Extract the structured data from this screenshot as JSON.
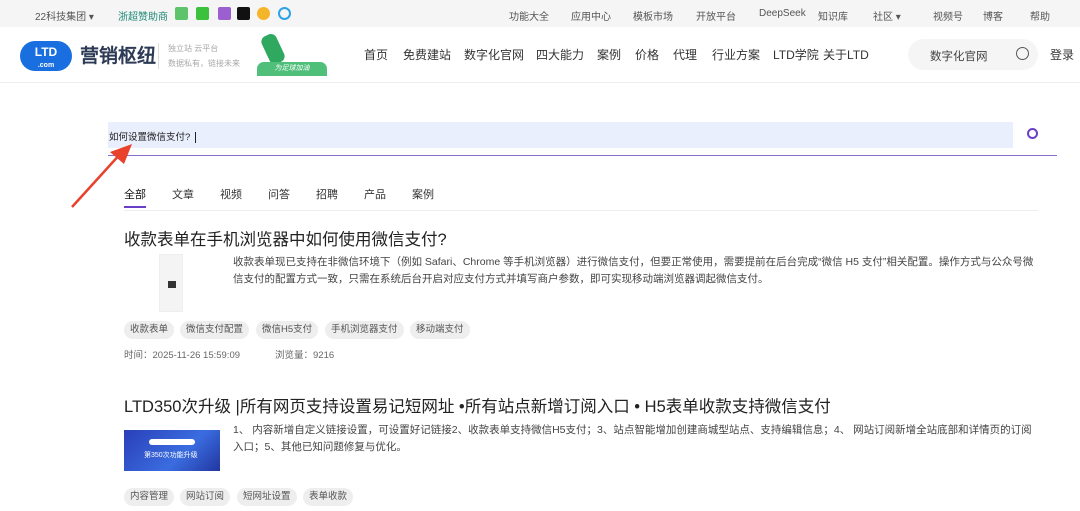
{
  "topbar": {
    "group": "22科技集团",
    "sponsor": "浙超赞助商",
    "links": [
      "功能大全",
      "应用中心",
      "模板市场",
      "开放平台",
      "DeepSeek",
      "知识库",
      "社区",
      "视频号",
      "博客",
      "帮助"
    ]
  },
  "header": {
    "logo_text": "营销枢纽",
    "logo_badge": "LTD",
    "logo_sub": ".com",
    "slogan1": "独立站 云平台",
    "slogan2": "数据私有，链接未来",
    "banner_text": "为足球加油",
    "nav": [
      "首页",
      "免费建站",
      "数字化官网",
      "四大能力",
      "案例",
      "价格",
      "代理",
      "行业方案",
      "LTD学院",
      "关于LTD"
    ],
    "search_value": "数字化官网",
    "login": "登录"
  },
  "search": {
    "value": "如何设置微信支付?"
  },
  "tabs": [
    "全部",
    "文章",
    "视频",
    "问答",
    "招聘",
    "产品",
    "案例"
  ],
  "results": [
    {
      "title": "收款表单在手机浏览器中如何使用微信支付?",
      "desc": "收款表单现已支持在非微信环境下（例如 Safari、Chrome 等手机浏览器）进行微信支付，但要正常使用，需要提前在后台完成“微信 H5 支付”相关配置。操作方式与公众号微信支付的配置方式一致，只需在系统后台开启对应支付方式并填写商户参数，即可实现移动端浏览器调起微信支付。",
      "tags": [
        "收款表单",
        "微信支付配置",
        "微信H5支付",
        "手机浏览器支付",
        "移动端支付"
      ],
      "time": "时间：2025-11-26 15:59:09",
      "views": "浏览量：9216"
    },
    {
      "title": "LTD350次升级 |所有网页支持设置易记短网址 •所有站点新增订阅入口 • H5表单收款支持微信支付",
      "desc": "1、 内容新增自定义链接设置，可设置好记链接2、收款表单支持微信H5支付；3、站点智能增加创建商城型站点、支持编辑信息；4、 网站订阅新增全站底部和详情页的订阅入口；5、其他已知问题修复与优化。",
      "image_text": "第350次功能升级",
      "tags": [
        "内容管理",
        "网站订阅",
        "短网址设置",
        "表单收款"
      ]
    }
  ],
  "colors": {
    "accent": "#6a3fc7",
    "brand": "#1a6fe0",
    "annotation": "#e8412c"
  }
}
